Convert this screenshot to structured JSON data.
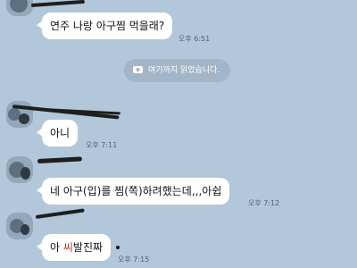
{
  "messages": [
    {
      "text": "연주 나랑 아구찜 먹을래?",
      "time": "오후 6:51"
    },
    {
      "text": "아니",
      "time": "오후 7:11"
    },
    {
      "text": "네 아구(입)를 찜(쪽)하려했는데,,,아쉽",
      "time": "오후 7:12"
    },
    {
      "text_prefix": "아 ",
      "text_censored": "씨",
      "text_suffix": "발진짜",
      "time": "오후 7:15"
    }
  ],
  "read_marker": {
    "label": "여기까지 읽었습니다.",
    "icon": "eye-icon"
  },
  "colors": {
    "background": "#b2c7d9",
    "bubble": "#ffffff",
    "notice_bg": "#a3b6c8",
    "censored_text": "#c0392b"
  }
}
